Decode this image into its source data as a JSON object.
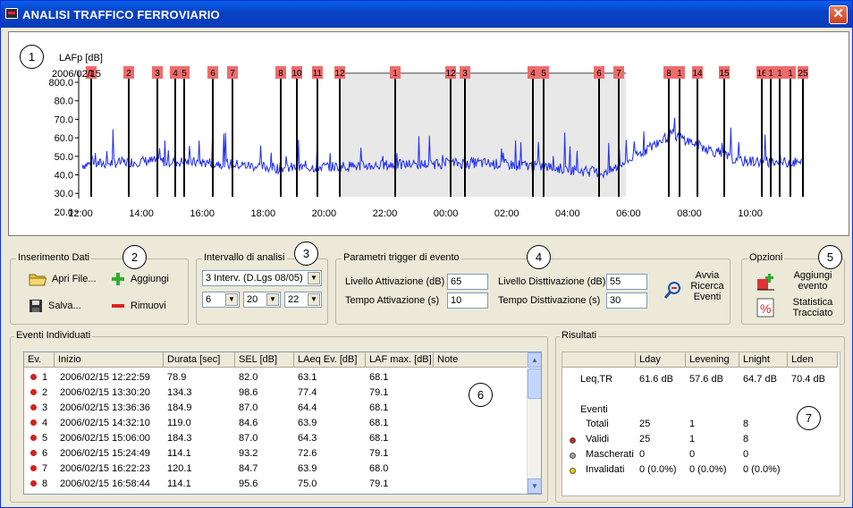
{
  "window": {
    "title": "ANALISI TRAFFICO FERROVIARIO"
  },
  "chart": {
    "number": "1",
    "ylabel": "LAFp [dB]",
    "date_label": "2006/02/15",
    "yticks": [
      "800.0",
      "80.0",
      "70.0",
      "60.0",
      "50.0",
      "40.0",
      "30.0",
      "20.0"
    ],
    "xticks": [
      "12:00",
      "14:00",
      "16:00",
      "18:00",
      "20:00",
      "22:00",
      "00:00",
      "02:00",
      "04:00",
      "06:00",
      "08:00",
      "10:00"
    ],
    "event_labels": [
      "1",
      "2",
      "3",
      "4",
      "5",
      "6",
      "7",
      "8",
      "10",
      "11",
      "12",
      "1",
      "12",
      "3",
      "4",
      "5",
      "6",
      "7",
      "8",
      "1",
      "14",
      "15",
      "16",
      "1",
      "1",
      "1",
      "25"
    ],
    "colors": {
      "series": "#1f2ef0",
      "event_marker": "#ef6c6c",
      "masked_region": "#d8d8d8"
    }
  },
  "chart_data": {
    "type": "line",
    "title": "",
    "xlabel": "",
    "ylabel": "LAFp [dB]",
    "ylim": [
      20,
      90
    ],
    "x": [
      "12:00",
      "14:00",
      "16:00",
      "18:00",
      "20:00",
      "22:00",
      "00:00",
      "02:00",
      "04:00",
      "06:00",
      "08:00",
      "10:00"
    ],
    "series": [
      {
        "values": [
          38,
          40,
          39,
          36,
          37,
          38,
          39,
          37,
          33,
          55,
          40,
          39
        ]
      }
    ]
  },
  "input_data": {
    "number": "2",
    "label": "Inserimento Dati",
    "open_file": "Apri File...",
    "add": "Aggiungi",
    "save": "Salva...",
    "remove": "Rimuovi"
  },
  "interval": {
    "number": "3",
    "label": "Intervallo di analisi",
    "interval_value": "3 Interv. (D.Lgs 08/05)",
    "val1": "6",
    "val2": "20",
    "val3": "22"
  },
  "trigger": {
    "number": "4",
    "label": "Parametri trigger di evento",
    "activation_level_label": "Livello Attivazione (dB)",
    "activation_level": "65",
    "deactivation_level_label": "Livello Disttivazione (dB)",
    "deactivation_level": "55",
    "activation_time_label": "Tempo Attivazione (s)",
    "activation_time": "10",
    "deactivation_time_label": "Tempo Disttivazione (s)",
    "deactivation_time": "30",
    "search_button": "Avvia Ricerca Eventi"
  },
  "options": {
    "number": "5",
    "label": "Opzioni",
    "add_event": "Aggiungi evento",
    "statistics": "Statistica Tracciato"
  },
  "events": {
    "number": "6",
    "label": "Eventi Individuati",
    "headers": [
      "Ev.",
      "Inizio",
      "Durata [sec]",
      "SEL [dB]",
      "LAeq Ev. [dB]",
      "LAF max. [dB]",
      "Note"
    ],
    "rows": [
      {
        "ev": "1",
        "start": "2006/02/15 12:22:59",
        "duration": "78.9",
        "sel": "82.0",
        "laeq": "63.1",
        "lafmax": "68.1"
      },
      {
        "ev": "2",
        "start": "2006/02/15 13:30:20",
        "duration": "134.3",
        "sel": "98.6",
        "laeq": "77.4",
        "lafmax": "79.1"
      },
      {
        "ev": "3",
        "start": "2006/02/15 13:36:36",
        "duration": "184.9",
        "sel": "87.0",
        "laeq": "64.4",
        "lafmax": "68.1"
      },
      {
        "ev": "4",
        "start": "2006/02/15 14:32:10",
        "duration": "119.0",
        "sel": "84.6",
        "laeq": "63.9",
        "lafmax": "68.1"
      },
      {
        "ev": "5",
        "start": "2006/02/15 15:06:00",
        "duration": "184.3",
        "sel": "87.0",
        "laeq": "64.3",
        "lafmax": "68.1"
      },
      {
        "ev": "6",
        "start": "2006/02/15 15:24:49",
        "duration": "114.1",
        "sel": "93.2",
        "laeq": "72.6",
        "lafmax": "79.1"
      },
      {
        "ev": "7",
        "start": "2006/02/15 16:22:23",
        "duration": "120.1",
        "sel": "84.7",
        "laeq": "63.9",
        "lafmax": "68.0"
      },
      {
        "ev": "8",
        "start": "2006/02/15 16:58:44",
        "duration": "114.1",
        "sel": "95.6",
        "laeq": "75.0",
        "lafmax": "79.1"
      }
    ],
    "dot_color": "#d42020"
  },
  "results": {
    "number": "7",
    "label": "Risultati",
    "headers": [
      "Lday",
      "Levening",
      "Lnight",
      "Lden"
    ],
    "leq_label": "Leq,TR",
    "leq_values": [
      "61.6 dB",
      "57.6 dB",
      "64.7 dB",
      "70.4 dB"
    ],
    "events_label": "Eventi",
    "rows": [
      {
        "label": "Totali",
        "values": [
          "25",
          "1",
          "8"
        ],
        "dot": ""
      },
      {
        "label": "Validi",
        "values": [
          "25",
          "1",
          "8"
        ],
        "dot": "#d42020"
      },
      {
        "label": "Mascherati",
        "values": [
          "0",
          "0",
          "0"
        ],
        "dot": "#a0a0a0"
      },
      {
        "label": "Invalidati",
        "values": [
          "0 (0.0%)",
          "0 (0.0%)",
          "0 (0.0%)"
        ],
        "dot": "#f0d000"
      }
    ]
  }
}
